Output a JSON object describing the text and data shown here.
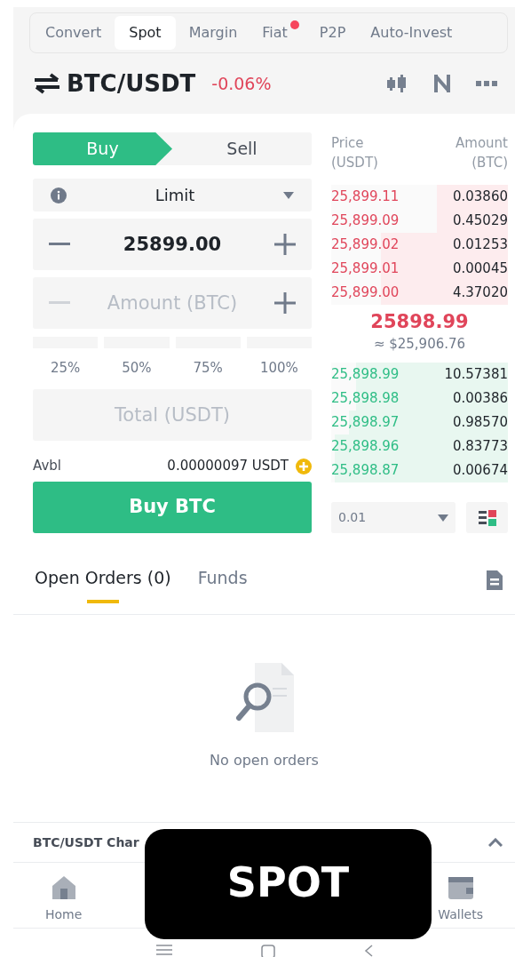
{
  "top_tabs": [
    {
      "label": "Convert",
      "selected": false,
      "dot": false
    },
    {
      "label": "Spot",
      "selected": true,
      "dot": false
    },
    {
      "label": "Margin",
      "selected": false,
      "dot": false
    },
    {
      "label": "Fiat",
      "selected": false,
      "dot": true
    },
    {
      "label": "P2P",
      "selected": false,
      "dot": false
    },
    {
      "label": "Auto-Invest",
      "selected": false,
      "dot": false
    }
  ],
  "pair": {
    "symbol": "BTC/USDT",
    "change": "-0.06%"
  },
  "side_tabs": [
    {
      "label": "Buy",
      "selected": true
    },
    {
      "label": "Sell",
      "selected": false
    }
  ],
  "order_type": "Limit",
  "price_field": {
    "value": "25899.00"
  },
  "amount_field": {
    "placeholder": "Amount (BTC)"
  },
  "percentages": [
    "25%",
    "50%",
    "75%",
    "100%"
  ],
  "total_field": {
    "placeholder": "Total (USDT)"
  },
  "available": {
    "label": "Avbl",
    "value": "0.00000097 USDT"
  },
  "submit_button": "Buy BTC",
  "order_book": {
    "price_header": "Price\n(USDT)",
    "amount_header": "Amount\n(BTC)",
    "asks": [
      {
        "price": "25,899.11",
        "amount": "0.03860",
        "level": 0.4
      },
      {
        "price": "25,899.09",
        "amount": "0.45029",
        "level": 0.4
      },
      {
        "price": "25,899.02",
        "amount": "0.01253",
        "level": 0.72
      },
      {
        "price": "25,899.01",
        "amount": "0.00045",
        "level": 0.72
      },
      {
        "price": "25,899.00",
        "amount": "4.37020",
        "level": 0.72
      }
    ],
    "last_price": "25898.99",
    "last_price_usd": "≈ $25,906.76",
    "bids": [
      {
        "price": "25,898.99",
        "amount": "10.57381",
        "level": 0.86
      },
      {
        "price": "25,898.98",
        "amount": "0.00386",
        "level": 0.86
      },
      {
        "price": "25,898.97",
        "amount": "0.98570",
        "level": 0.9
      },
      {
        "price": "25,898.96",
        "amount": "0.83773",
        "level": 0.98
      },
      {
        "price": "25,898.87",
        "amount": "0.00674",
        "level": 0.98
      }
    ],
    "precision": "0.01"
  },
  "bottom_tabs": [
    {
      "label": "Open Orders (0)",
      "selected": true
    },
    {
      "label": "Funds",
      "selected": false
    }
  ],
  "empty_message": "No open orders",
  "chart_bar": "BTC/USDT Char",
  "nav": [
    {
      "label": "Home",
      "kind": "home"
    },
    {
      "label": "Wallets",
      "kind": "wallet"
    }
  ],
  "caption": "SPOT"
}
